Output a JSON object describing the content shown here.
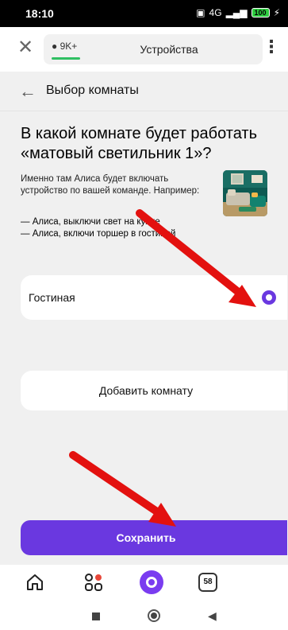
{
  "statusbar": {
    "time": "18:10",
    "network": "4G",
    "battery": "100"
  },
  "browser": {
    "chip_label": "9K+",
    "title": "Устройства"
  },
  "header": {
    "title": "Выбор комнаты"
  },
  "question": "В какой комнате будет работать «матовый светильник 1»?",
  "description": "Именно там Алиса будет включать устройство по вашей команде. Например:",
  "examples": [
    "— Алиса, выключи свет на кухне",
    "— Алиса, включи торшер в гостиной"
  ],
  "rooms": [
    {
      "label": "Гостиная",
      "selected": true
    }
  ],
  "add_room_label": "Добавить комнату",
  "save_label": "Сохранить",
  "bottom_nav": {
    "tabs_count": "58"
  },
  "colors": {
    "accent": "#6a38e0",
    "annotation_arrow": "#e3110f",
    "chip_bar": "#2fbf62"
  },
  "icons": {
    "close": "close-icon",
    "menu": "more-vertical-icon",
    "back": "arrow-left-icon",
    "home": "home-icon",
    "services": "services-grid-icon",
    "alice": "alice-icon",
    "tabs": "tabs-icon"
  }
}
